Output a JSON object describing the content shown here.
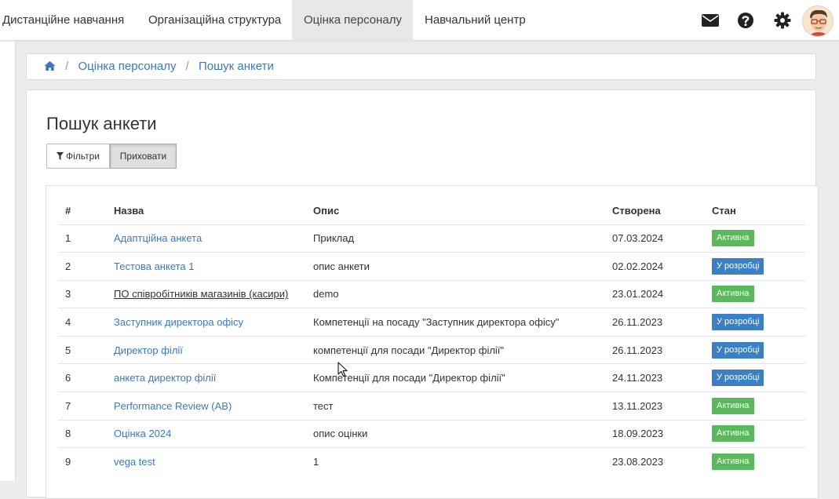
{
  "nav": {
    "items": [
      {
        "label": "Дистанційне навчання"
      },
      {
        "label": "Організаційна структура"
      },
      {
        "label": "Оцінка персоналу",
        "active": true
      },
      {
        "label": "Навчальний центр"
      }
    ],
    "icons": [
      "envelope-icon",
      "question-circle-icon",
      "gear-icon"
    ]
  },
  "breadcrumb": {
    "items": [
      "Оцінка персоналу",
      "Пошук анкети"
    ]
  },
  "page": {
    "title": "Пошук анкети",
    "filters_label": "Фільтри",
    "hide_label": "Приховати"
  },
  "table": {
    "headers": [
      "#",
      "Назва",
      "Опис",
      "Створена",
      "Стан"
    ],
    "rows": [
      {
        "num": "1",
        "name": "Адаптційна анкета",
        "desc": "Приклад",
        "created": "07.03.2024",
        "status": "Активна",
        "status_type": "active"
      },
      {
        "num": "2",
        "name": "Тестова анкета 1",
        "desc": "опис анкети",
        "created": "02.02.2024",
        "status": "У розробці",
        "status_type": "dev"
      },
      {
        "num": "3",
        "name": "ПО співробітників магазинів (касири)",
        "desc": "demo",
        "created": "23.01.2024",
        "status": "Активна",
        "status_type": "active"
      },
      {
        "num": "4",
        "name": "Заступник директора офісу",
        "desc": "Компетенції на посаду \"Заступник директора офісу\"",
        "created": "26.11.2023",
        "status": "У розробці",
        "status_type": "dev"
      },
      {
        "num": "5",
        "name": "Директор філії",
        "desc": "компетенції для посади \"Директор філії\"",
        "created": "26.11.2023",
        "status": "У розробці",
        "status_type": "dev"
      },
      {
        "num": "6",
        "name": "анкета директор філії",
        "desc": "Компетенції для посади \"Директор філії\"",
        "created": "24.11.2023",
        "status": "У розробці",
        "status_type": "dev"
      },
      {
        "num": "7",
        "name": "Performance Review (AB)",
        "desc": "тест",
        "created": "13.11.2023",
        "status": "Активна",
        "status_type": "active"
      },
      {
        "num": "8",
        "name": "Оцінка 2024",
        "desc": "опис оцінки",
        "created": "18.09.2023",
        "status": "Активна",
        "status_type": "active"
      },
      {
        "num": "9",
        "name": "vega test",
        "desc": "1",
        "created": "23.08.2023",
        "status": "Активна",
        "status_type": "active"
      }
    ]
  },
  "colors": {
    "link": "#3a78c3",
    "active_badge": "#5cb85c",
    "dev_badge": "#3b7fc4"
  }
}
